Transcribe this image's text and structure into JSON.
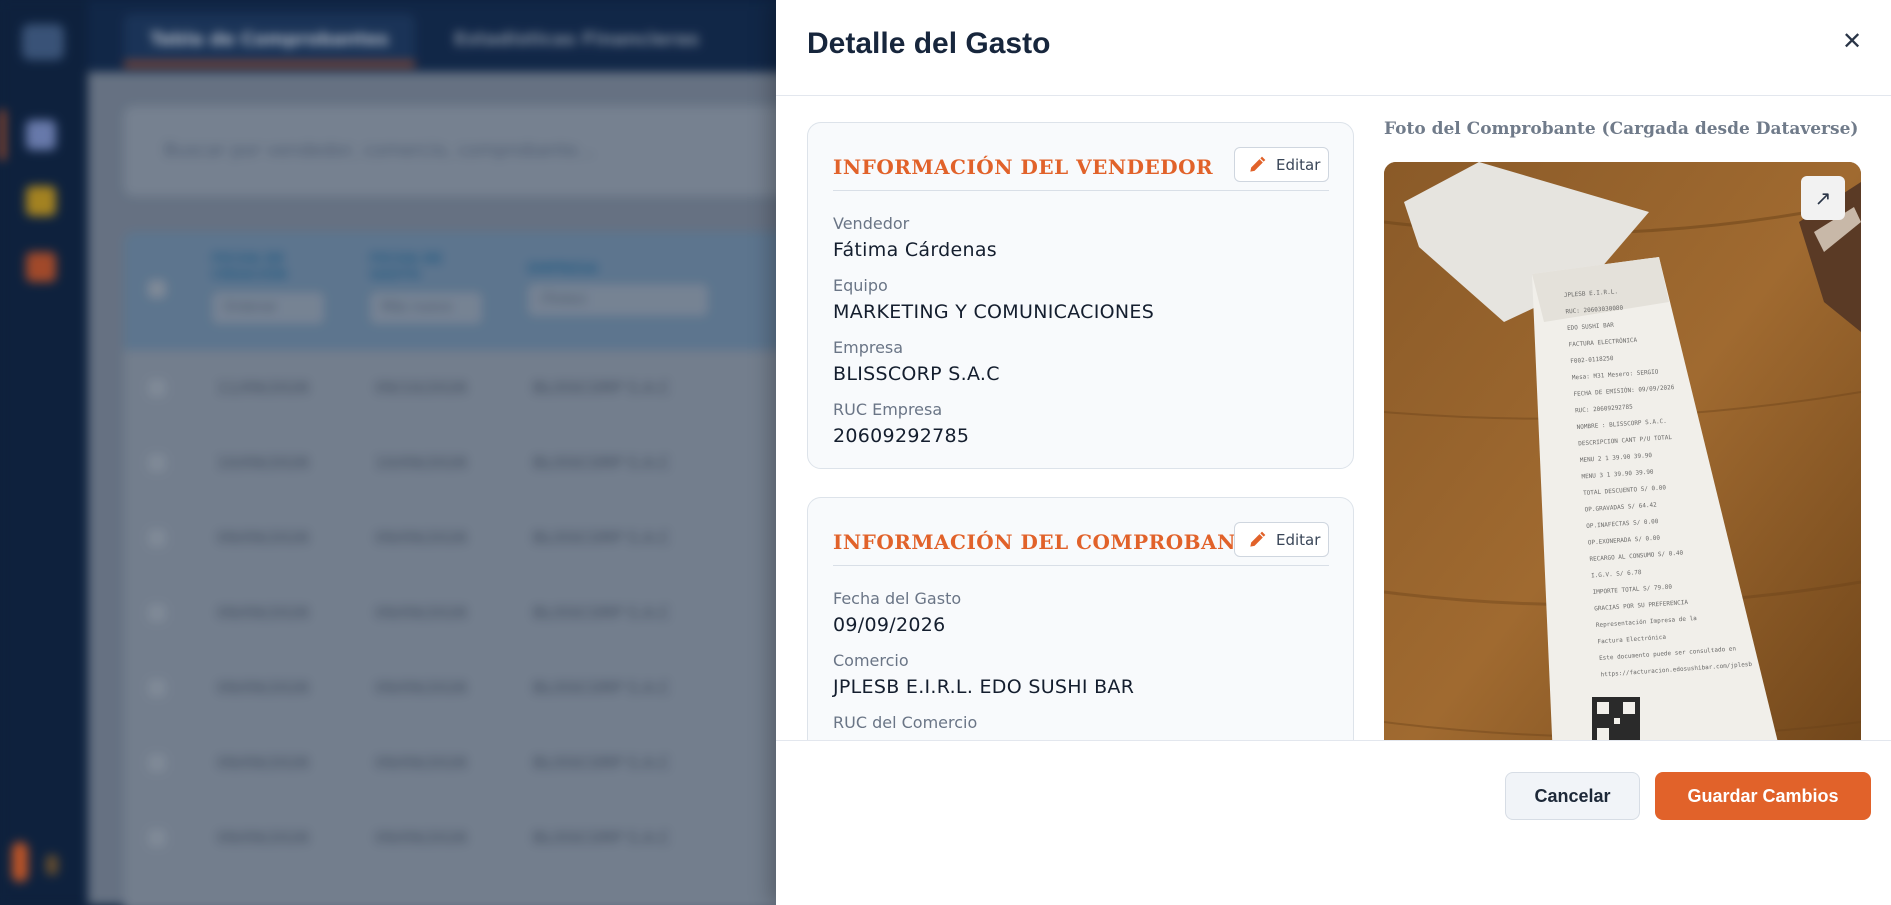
{
  "background": {
    "tabs": [
      "Tabla de Comprobantes",
      "Estadísticas Financieras"
    ],
    "search_placeholder": "Buscar por vendedor, comercio, comprobante...",
    "columns": [
      "FECHA DE CREACIÓN",
      "FECHA DE GASTO",
      "EMPRESA"
    ],
    "column_filters": [
      "Ordenar",
      "Más nuevo",
      "(Todas)"
    ],
    "rows": [
      {
        "created": "11/09/2026",
        "expense": "09/10/2026",
        "company": "BLISSCORP S.A.C"
      },
      {
        "created": "10/09/2026",
        "expense": "10/09/2026",
        "company": "BLISSCORP S.A.C"
      },
      {
        "created": "09/09/2026",
        "expense": "09/09/2026",
        "company": "BLISSCORP S.A.C"
      },
      {
        "created": "09/09/2026",
        "expense": "09/09/2026",
        "company": "BLISSCORP S.A.C"
      },
      {
        "created": "09/09/2026",
        "expense": "09/09/2026",
        "company": "BLISSCORP S.A.C"
      },
      {
        "created": "09/09/2026",
        "expense": "09/09/2026",
        "company": "BLISSCORP S.A.C"
      },
      {
        "created": "09/09/2026",
        "expense": "09/09/2026",
        "company": "BLISSCORP S.A.C"
      }
    ]
  },
  "drawer": {
    "title": "Detalle del Gasto",
    "close_icon": "close-icon",
    "vendor_card": {
      "title": "INFORMACIÓN DEL VENDEDOR",
      "edit_label": "Editar",
      "fields": [
        {
          "label": "Vendedor",
          "value": "Fátima Cárdenas"
        },
        {
          "label": "Equipo",
          "value": "MARKETING Y COMUNICACIONES"
        },
        {
          "label": "Empresa",
          "value": "BLISSCORP S.A.C"
        },
        {
          "label": "RUC Empresa",
          "value": "20609292785"
        }
      ]
    },
    "receipt_card": {
      "title": "INFORMACIÓN DEL COMPROBANTE",
      "edit_label": "Editar",
      "fields": [
        {
          "label": "Fecha del Gasto",
          "value": "09/09/2026"
        },
        {
          "label": "Comercio",
          "value": "JPLESB E.I.R.L. EDO SUSHI BAR"
        },
        {
          "label": "RUC del Comercio",
          "value": ""
        }
      ]
    },
    "photo": {
      "label": "Foto del Comprobante (Cargada desde Dataverse)",
      "expand_icon": "expand-icon",
      "receipt_lines": [
        "JPLESB E.I.R.L.",
        "RUC: 20603030080",
        "EDO SUSHI BAR",
        "FACTURA ELECTRÓNICA",
        "F002-0118250",
        "Mesa: M31  Mesero: SERGIO",
        "FECHA DE EMISIÓN: 09/09/2026",
        "RUC: 20609292785",
        "NOMBRE : BLISSCORP S.A.C.",
        "DESCRIPCION  CANT  P/U  TOTAL",
        "MENU 2   1   39.90   39.90",
        "MENU 3   1   39.90   39.90",
        "TOTAL DESCUENTO   S/   0.00",
        "OP.GRAVADAS   S/   64.42",
        "OP.INAFECTAS   S/   0.00",
        "OP.EXONERADA   S/   0.00",
        "RECARGO AL CONSUMO   S/   0.40",
        "I.G.V.   S/   6.78",
        "IMPORTE TOTAL   S/   79.80",
        "GRACIAS POR SU PREFERENCIA",
        "Representación Impresa de la",
        "Factura Electrónica",
        "Este documento puede ser consultado en",
        "https://facturacion.edosushibar.com/jplesb"
      ]
    },
    "footer": {
      "cancel_label": "Cancelar",
      "save_label": "Guardar Cambios"
    }
  },
  "colors": {
    "accent": "#e1622a",
    "navy": "#0f2444",
    "text_dark": "#141e2e",
    "muted": "#6a7586"
  }
}
